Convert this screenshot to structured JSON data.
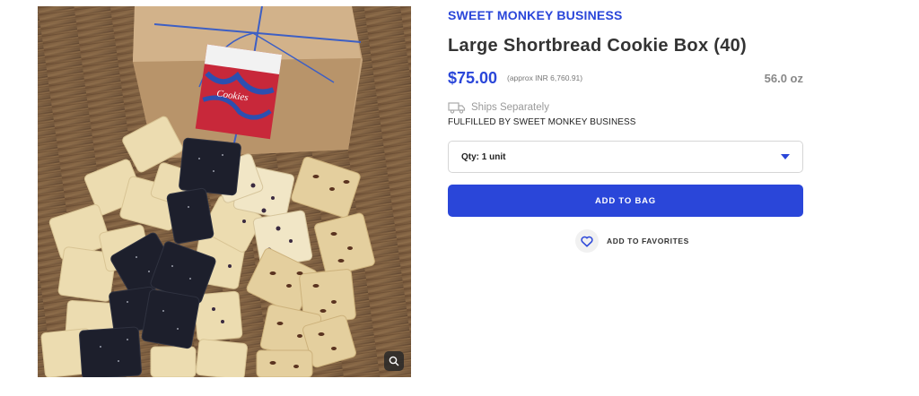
{
  "product": {
    "brand": "SWEET MONKEY BUSINESS",
    "title": "Large Shortbread Cookie Box (40)",
    "price": "$75.00",
    "approx_price": "(approx INR 6,760.91)",
    "weight": "56.0 oz",
    "ships_text": "Ships Separately",
    "fulfilled_by": "FULFILLED BY SWEET MONKEY BUSINESS",
    "quantity_selected": "Qty: 1 unit",
    "add_to_bag_label": "ADD TO BAG",
    "add_to_favorites_label": "ADD TO FAVORITES",
    "box_tag_text": "Cookies"
  },
  "icons": {
    "ships": "truck-icon",
    "favorites": "heart-icon",
    "zoom": "magnifier-icon",
    "dropdown": "caret-down-icon"
  },
  "colors": {
    "accent": "#2a46d9",
    "muted": "#888888"
  }
}
